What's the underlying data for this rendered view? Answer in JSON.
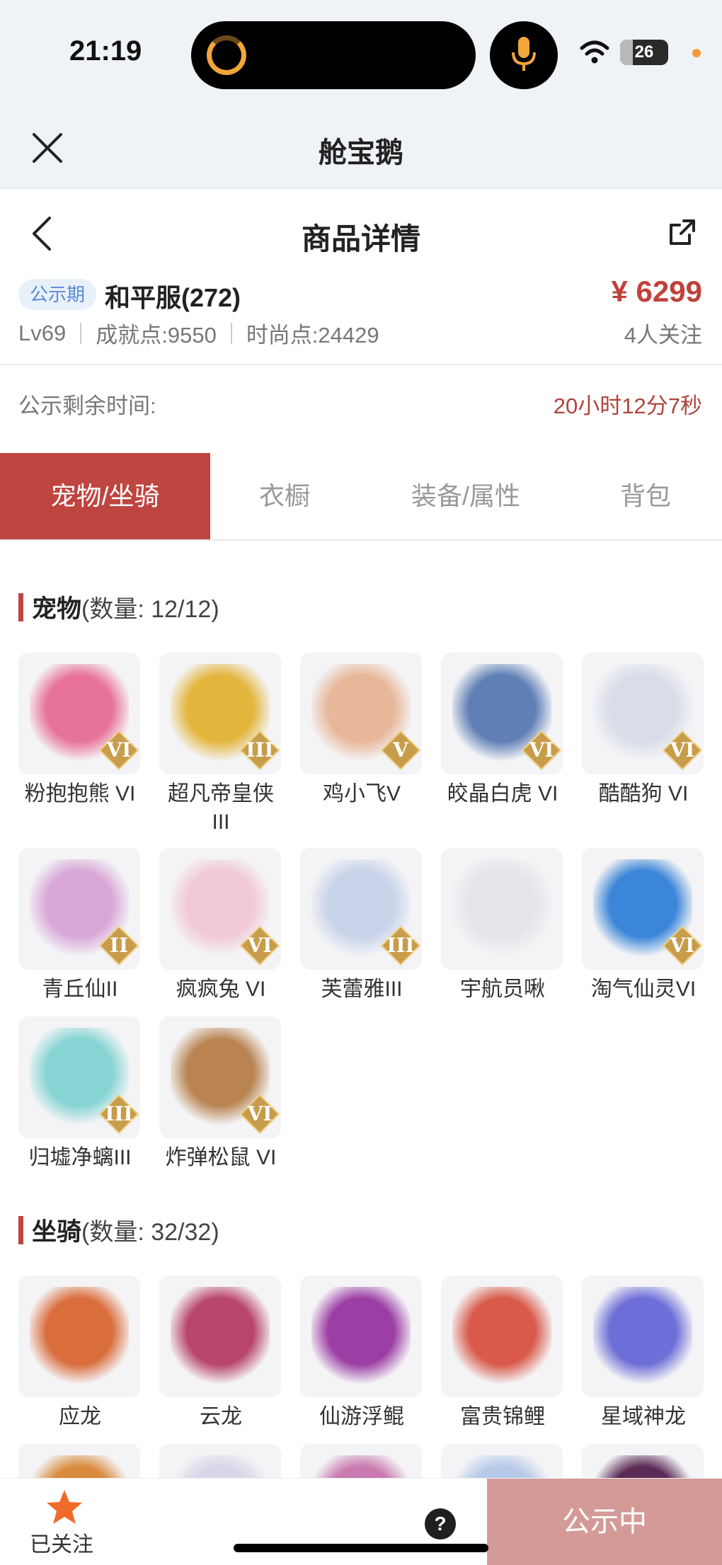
{
  "status": {
    "time": "21:19",
    "battery": "26",
    "battery_level": 0.26
  },
  "miniapp": {
    "title": "舱宝鹅"
  },
  "nav": {
    "title": "商品详情"
  },
  "listing": {
    "badge": "公示期",
    "server": "和平服(272)",
    "price": "¥ 6299",
    "level": "Lv69",
    "achievement": "成就点:9550",
    "fashion": "时尚点:24429",
    "followers": "4人关注",
    "countdown_label": "公示剩余时间:",
    "countdown_value": "20小时12分7秒"
  },
  "tabs": [
    "宠物/坐骑",
    "衣橱",
    "装备/属性",
    "背包"
  ],
  "pets_section": {
    "title": "宠物",
    "count": "(数量: 12/12)"
  },
  "pets": [
    {
      "name": "粉抱抱熊 VI",
      "tier": "VI",
      "color": "#e8739a"
    },
    {
      "name": "超凡帝皇侠III",
      "tier": "III",
      "color": "#e3b63e"
    },
    {
      "name": "鸡小飞V",
      "tier": "V",
      "color": "#e8b79a"
    },
    {
      "name": "皎晶白虎 VI",
      "tier": "VI",
      "color": "#5f7fb5"
    },
    {
      "name": "酷酷狗 VI",
      "tier": "VI",
      "color": "#d9dde8"
    },
    {
      "name": "青丘仙II",
      "tier": "II",
      "color": "#d9a8d8"
    },
    {
      "name": "疯疯兔 VI",
      "tier": "VI",
      "color": "#f1c9d8"
    },
    {
      "name": "芙蕾雅III",
      "tier": "III",
      "color": "#c8d3ea"
    },
    {
      "name": "宇航员啾",
      "tier": "",
      "color": "#e4e4ea"
    },
    {
      "name": "淘气仙灵VI",
      "tier": "VI",
      "color": "#3b86d8"
    },
    {
      "name": "归墟净螭III",
      "tier": "III",
      "color": "#86d4d3"
    },
    {
      "name": "炸弹松鼠 VI",
      "tier": "VI",
      "color": "#b98452"
    }
  ],
  "mounts_section": {
    "title": "坐骑",
    "count": "(数量: 32/32)"
  },
  "mounts": [
    {
      "name": "应龙",
      "color": "#d96d3c"
    },
    {
      "name": "云龙",
      "color": "#b8456a"
    },
    {
      "name": "仙游浮鲲",
      "color": "#9c3fa5"
    },
    {
      "name": "富贵锦鲤",
      "color": "#d95a4a"
    },
    {
      "name": "星域神龙",
      "color": "#6e6ed8"
    }
  ],
  "mounts_row2_colors": [
    "#d98a3c",
    "#d7d7e8",
    "#c97ab0",
    "#b7c9e8",
    "#5a2a55"
  ],
  "bottom": {
    "follow_label": "已关注",
    "help": "?",
    "action": "公示中"
  }
}
